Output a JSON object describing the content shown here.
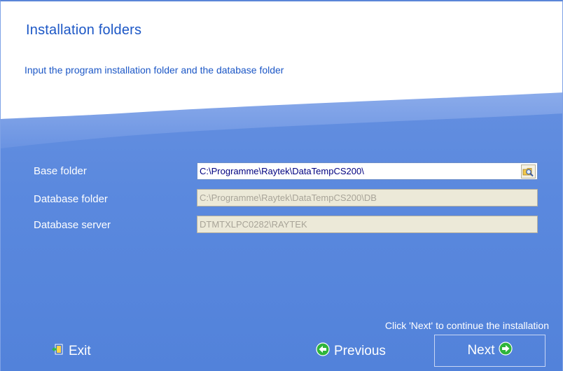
{
  "header": {
    "title": "Installation folders",
    "subtitle": "Input the program installation folder and the database folder"
  },
  "fields": [
    {
      "label": "Base folder",
      "value": "C:\\Programme\\Raytek\\DataTempCS200\\",
      "enabled": true
    },
    {
      "label": "Database folder",
      "value": "C:\\Programme\\Raytek\\DataTempCS200\\DB",
      "enabled": false
    },
    {
      "label": "Database server",
      "value": "DTMTXLPC0282\\RAYTEK",
      "enabled": false
    }
  ],
  "icons": {
    "browse": "folder-search-icon",
    "exit": "exit-door-icon",
    "previous": "arrow-left-circle-icon",
    "next": "arrow-right-circle-icon"
  },
  "footer": {
    "hint": "Click 'Next' to continue the installation",
    "exit_label": "Exit",
    "previous_label": "Previous",
    "next_label": "Next"
  },
  "colors": {
    "background": "#5585de",
    "title_text": "#1c57c6",
    "label_text": "#ffffff",
    "disabled_field": "#ece9d8",
    "button_icon_green": "#2fb53a"
  }
}
